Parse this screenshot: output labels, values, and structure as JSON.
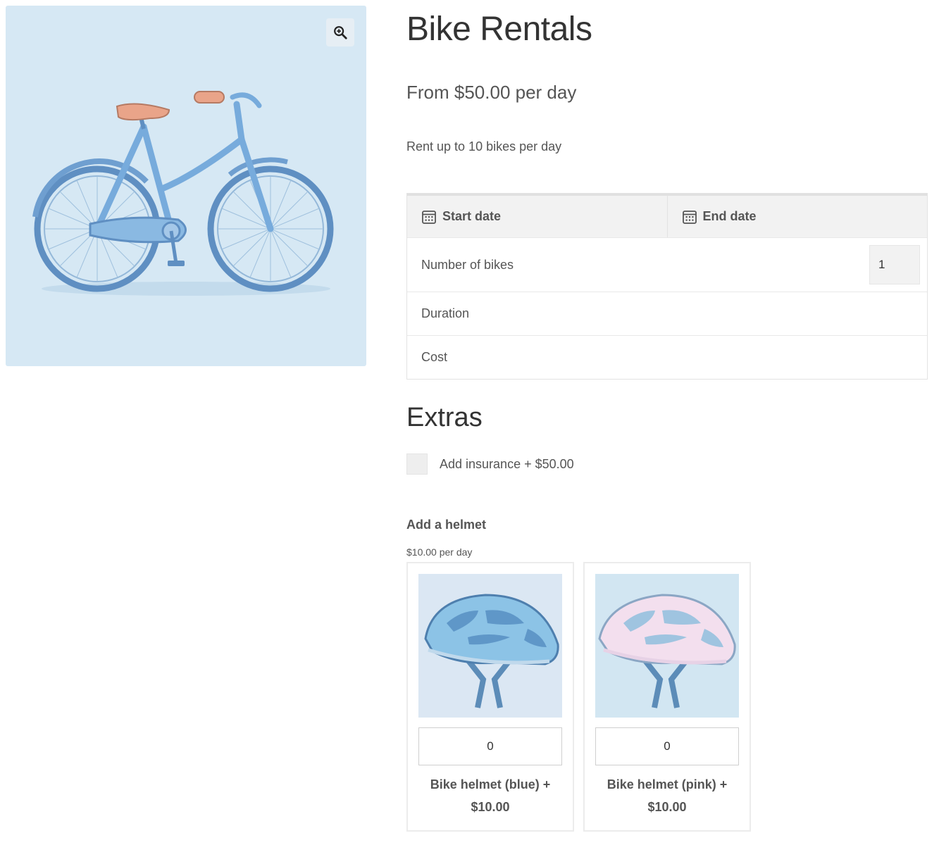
{
  "product": {
    "title": "Bike Rentals",
    "price": "From $50.00 per day",
    "description": "Rent up to 10 bikes per day"
  },
  "gallery": {
    "image_icon": "bicycle-illustration",
    "zoom_icon": "magnifier-plus-icon",
    "background": "#d6e8f4"
  },
  "booking": {
    "start_date_label": "Start date",
    "end_date_label": "End date",
    "calendar_icon": "calendar-icon",
    "number_of_bikes_label": "Number of bikes",
    "number_of_bikes_value": "1",
    "duration_label": "Duration",
    "cost_label": "Cost"
  },
  "extras": {
    "title": "Extras",
    "insurance_label": "Add insurance + $50.00",
    "insurance_checked": false
  },
  "helmets": {
    "title": "Add a helmet",
    "subtitle": "$10.00 per day",
    "items": [
      {
        "name": "Bike helmet (blue) +",
        "price": "$10.00",
        "quantity": "0",
        "icon": "blue-helmet-image",
        "color": "#8cc3e6"
      },
      {
        "name": "Bike helmet (pink) +",
        "price": "$10.00",
        "quantity": "0",
        "icon": "pink-helmet-image",
        "color": "#f3dfee"
      }
    ]
  }
}
